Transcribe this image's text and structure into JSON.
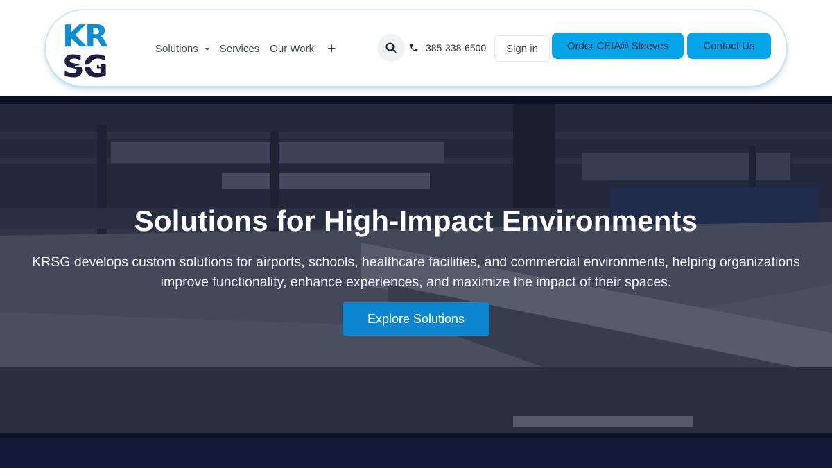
{
  "brand": {
    "logo_line1": "KR",
    "logo_line2": "SG",
    "colors": {
      "logo_top": "#0a8ed6",
      "logo_bottom": "#1c2140"
    }
  },
  "nav": {
    "items": [
      {
        "label": "Solutions",
        "has_dropdown": true
      },
      {
        "label": "Services"
      },
      {
        "label": "Our Work"
      }
    ],
    "more_icon": "plus-icon"
  },
  "header": {
    "search_icon": "search-icon",
    "phone_icon": "phone-icon",
    "phone": "385-338-6500",
    "signin_label": "Sign in",
    "order_label": "Order CEIA® Sleeves",
    "contact_label": "Contact Us"
  },
  "hero": {
    "title": "Solutions for High-Impact Environments",
    "desc_line1": "KRSG develops custom solutions for airports, schools, healthcare facilities, and commercial environments, helping organizations",
    "desc_line2": "improve functionality, enhance experiences, and maximize the impact of their spaces.",
    "cta_label": "Explore Solutions"
  },
  "colors": {
    "accent": "#04a4e8",
    "cta": "#0e85cf",
    "footer_band": "#141a3a"
  }
}
